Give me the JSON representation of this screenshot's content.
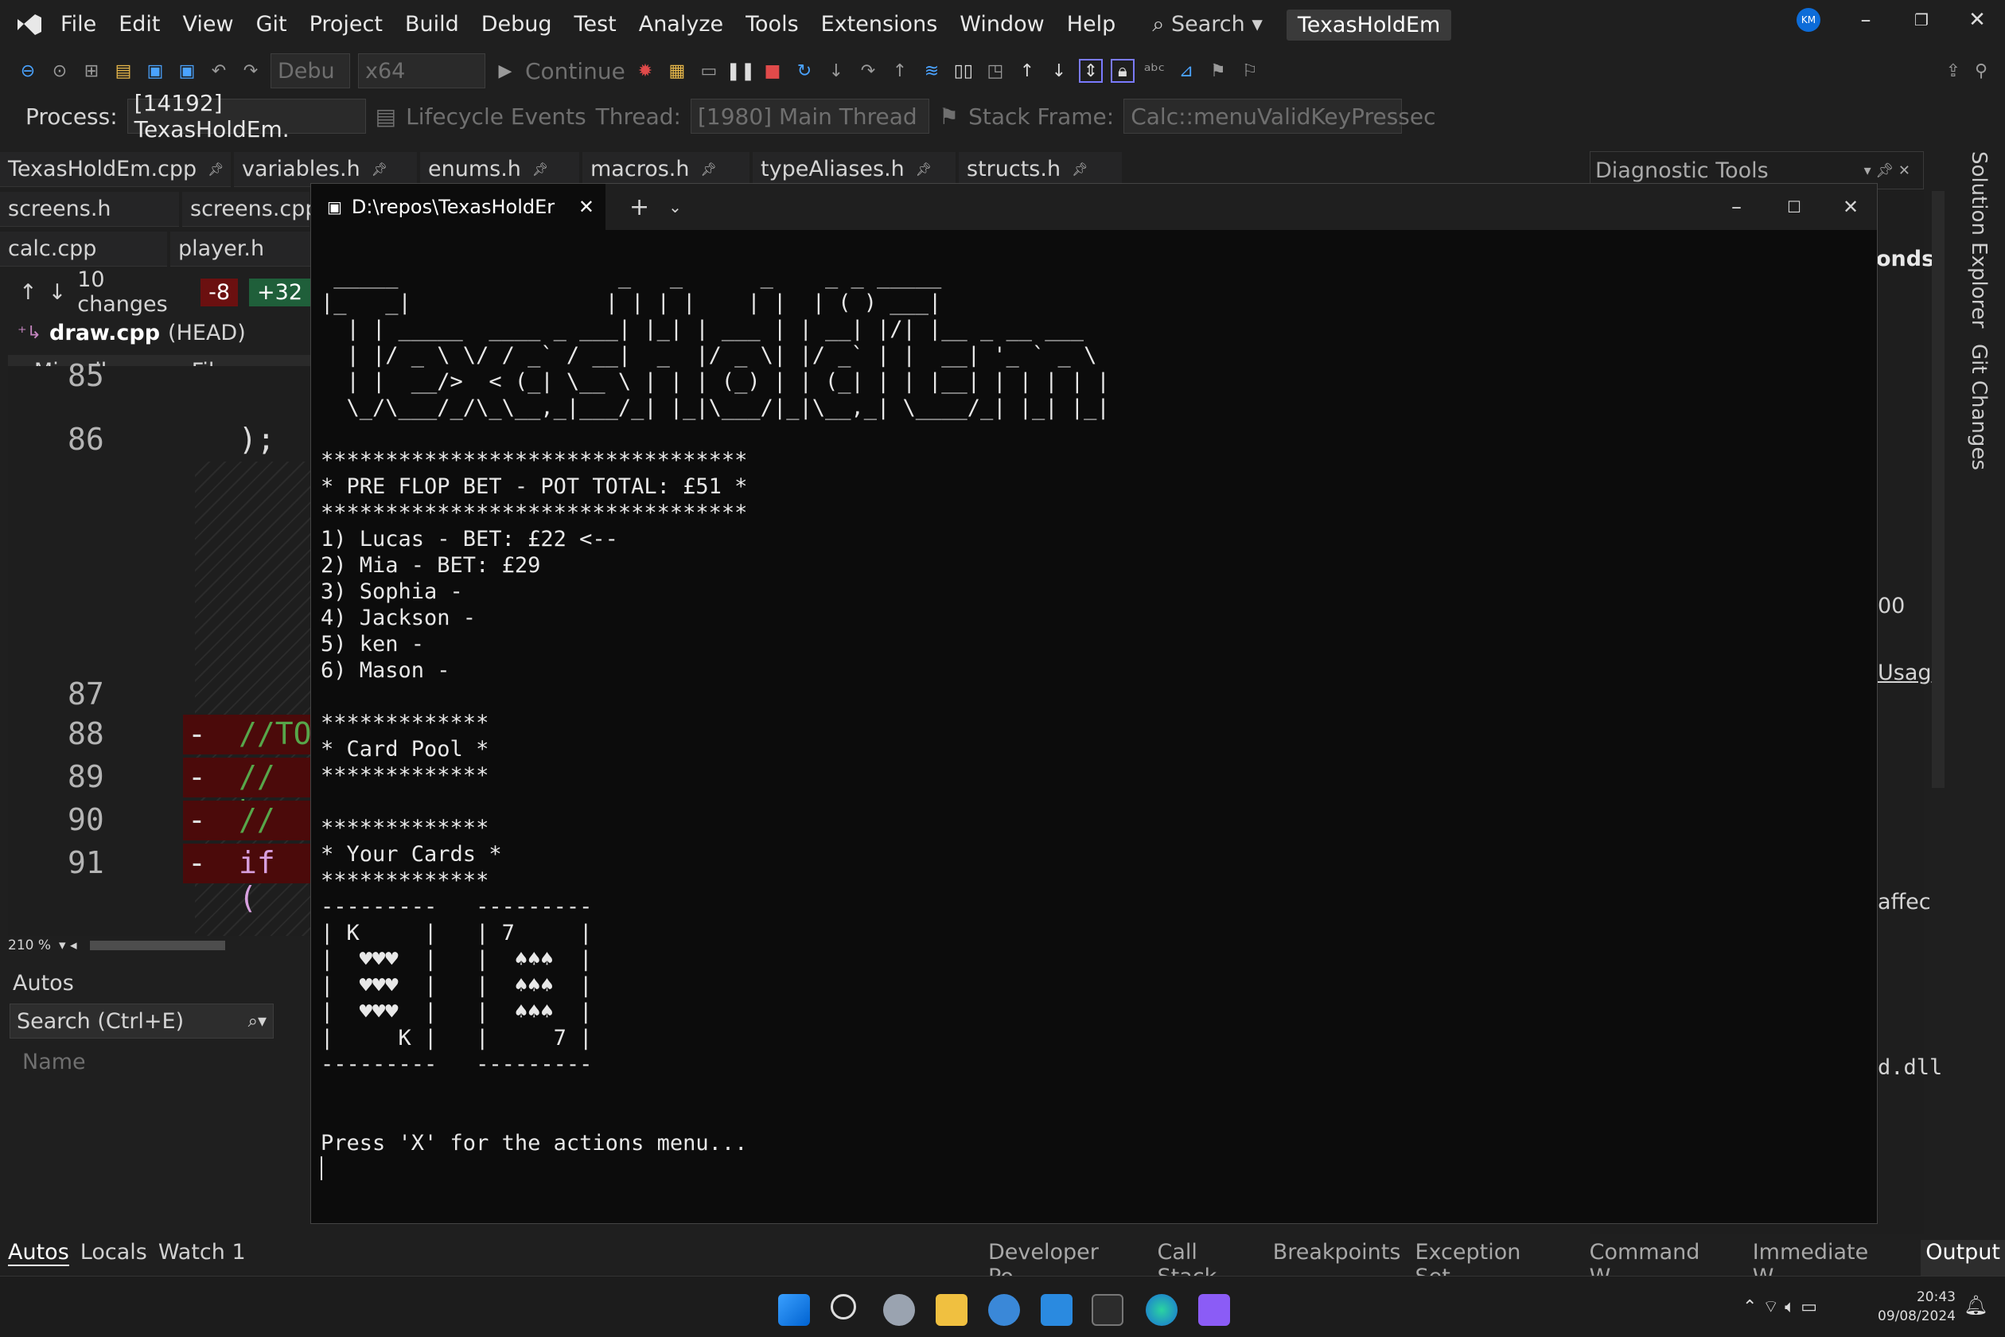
{
  "menubar": {
    "items": [
      "File",
      "Edit",
      "View",
      "Git",
      "Project",
      "Build",
      "Debug",
      "Test",
      "Analyze",
      "Tools",
      "Extensions",
      "Window",
      "Help"
    ],
    "search_label": "Search",
    "solution_name": "TexasHoldEm",
    "avatar_initials": "KM"
  },
  "toolbar": {
    "config": "Debu",
    "platform": "x64",
    "continue_label": "Continue"
  },
  "toolbar2": {
    "process_label": "Process:",
    "process_value": "[14192] TexasHoldEm.",
    "lifecycle_label": "Lifecycle Events",
    "thread_label": "Thread:",
    "thread_value": "[1980] Main Thread",
    "stackframe_label": "Stack Frame:",
    "stackframe_value": "Calc::menuValidKeyPressec"
  },
  "doc_tabs_row1": [
    "TexasHoldEm.cpp",
    "variables.h",
    "enums.h",
    "macros.h",
    "typeAliases.h",
    "structs.h"
  ],
  "doc_tabs_row2": [
    "screens.h",
    "screens.cpp"
  ],
  "doc_tabs_row3": [
    "calc.cpp",
    "player.h"
  ],
  "changes": {
    "label": "10 changes",
    "removed": "-8",
    "added": "+32"
  },
  "file_header": {
    "name": "draw.cpp",
    "ref": "(HEAD)"
  },
  "misc_files": "Miscellaneous Files",
  "editor_lines": [
    {
      "num": "85",
      "code": ""
    },
    {
      "num": "86",
      "code": ");"
    },
    {
      "num": "87",
      "code": ""
    },
    {
      "num": "88",
      "code": "//TO"
    },
    {
      "num": "89",
      "code": "// h"
    },
    {
      "num": "90",
      "code": "// t"
    },
    {
      "num": "91",
      "code": "if ("
    }
  ],
  "zoom": "210 %",
  "autos": {
    "title": "Autos",
    "search_placeholder": "Search (Ctrl+E)",
    "col_name": "Name"
  },
  "diagnostic": {
    "title": "Diagnostic Tools",
    "frag1": "onds",
    "frag2": "00",
    "frag3": "Usag",
    "frag4": "affec",
    "frag5": "d.dll"
  },
  "side_tabs": [
    "Solution Explorer",
    "Git Changes"
  ],
  "terminal": {
    "tab_title": "D:\\repos\\TexasHoldEr",
    "output": " _____                 _   _      _    _ _ _____\n|_   _|               | | | |    | |  | ( ) ___|\n  | | _____  ____ _ ___| |_| | ___ | | __| |/| |__ _ __ ___\n  | |/ _ \\ \\/ / _` / __|  _  |/ _ \\| |/ _` | |  __| '_ ` _ \\\n  | |  __/>  < (_| \\__ \\ | | | (_) | | (_| | | |__| | | | | |\n  \\_/\\___/_/\\_\\__,_|___/_| |_|\\___/|_|\\__,_| \\____/_| |_| |_|\n\n*********************************\n* PRE FLOP BET - POT TOTAL: £51 *\n*********************************\n1) Lucas - BET: £22 <--\n2) Mia - BET: £29\n3) Sophia -\n4) Jackson -\n5) ken -\n6) Mason -\n\n*************\n* Card Pool *\n*************\n\n*************\n* Your Cards *\n*************\n---------   ---------\n| K     |   | 7     |\n|  ♥♥♥  |   |  ♠♠♠  |\n|  ♥♥♥  |   |  ♠♠♠  |\n|  ♥♥♥  |   |  ♠♠♠  |\n|     K |   |     7 |\n---------   ---------\n\n\nPress 'X' for the actions menu..."
  },
  "bottom_left_tabs": [
    "Autos",
    "Locals",
    "Watch 1"
  ],
  "bottom_right_tabs": [
    "Developer Po...",
    "Call Stack",
    "Breakpoints",
    "Exception Set...",
    "Command W...",
    "Immediate W...",
    "Output"
  ],
  "clock": {
    "time": "20:43",
    "date": "09/08/2024"
  },
  "colors": {
    "accent": "#0e639c",
    "del_bg": "#4b0a0a",
    "add_bg": "#1f5f3a"
  }
}
